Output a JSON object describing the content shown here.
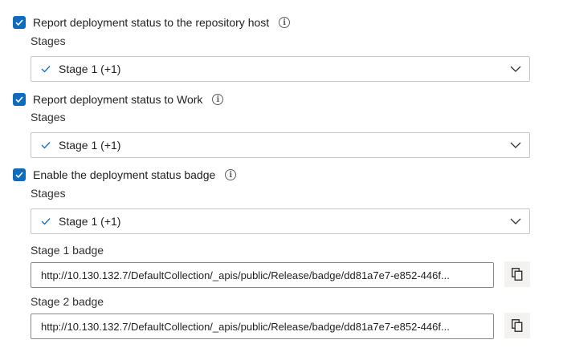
{
  "options": [
    {
      "checkbox_label": "Report deployment status to the repository host",
      "checked": true,
      "stages_label": "Stages",
      "stages_value": "Stage 1 (+1)"
    },
    {
      "checkbox_label": "Report deployment status to Work",
      "checked": true,
      "stages_label": "Stages",
      "stages_value": "Stage 1 (+1)"
    },
    {
      "checkbox_label": "Enable the deployment status badge",
      "checked": true,
      "stages_label": "Stages",
      "stages_value": "Stage 1 (+1)"
    }
  ],
  "badges": [
    {
      "label": "Stage 1 badge",
      "url": "http://10.130.132.7/DefaultCollection/_apis/public/Release/badge/dd81a7e7-e852-446f..."
    },
    {
      "label": "Stage 2 badge",
      "url": "http://10.130.132.7/DefaultCollection/_apis/public/Release/badge/dd81a7e7-e852-446f..."
    }
  ],
  "icons": {
    "info": "info-icon",
    "check": "checkmark-icon",
    "chevron": "chevron-down-icon",
    "copy": "copy-icon"
  },
  "colors": {
    "accent": "#0f6cbd",
    "border": "#c8c6c4",
    "text": "#201f1e"
  }
}
